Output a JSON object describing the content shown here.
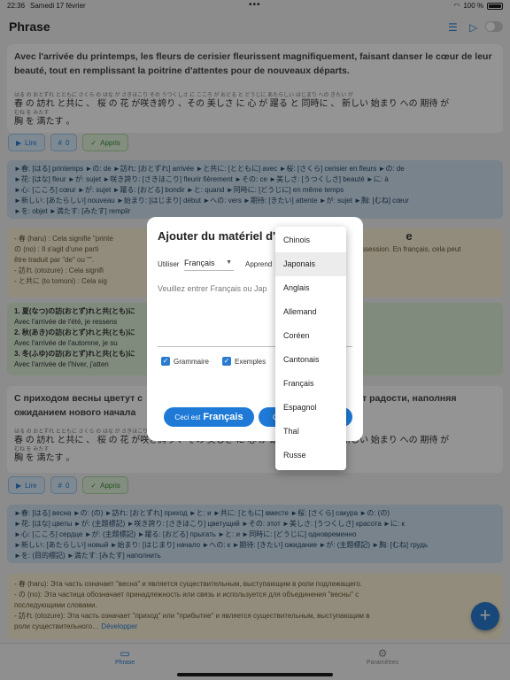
{
  "status": {
    "time": "22:36",
    "date": "Samedi 17 février",
    "battery": "100 %"
  },
  "nav": {
    "title": "Phrase",
    "list_icon": "list-icon",
    "play_icon": "play-icon"
  },
  "card1": {
    "sentence": "Avec l'arrivée du printemps, les fleurs de cerisier fleurissent magnifiquement, faisant danser le cœur de leur beauté, tout en remplissant la poitrine d'attentes pour de nouveaux départs.",
    "furigana": "はる の おとずれ とともに     さくら の はな が さきほこり    その うつくしさ に こころ が おどる と どうじに    あたらしい はじまり への きたい が",
    "japanese": "春 の 訪れ と共に 、 桜 の 花 が咲き誇り 、その 美しさ に 心 が 躍る と 同時に 、 新しい 始まり への 期待 が",
    "furigana2": "むね を  みたす",
    "japanese2": "胸 を 満たす 。"
  },
  "buttons": {
    "read": "Lire",
    "count": "0",
    "learned": "Appris"
  },
  "vocab1": [
    "►春: [はる] printemps ►の: de ►訪れ: [おとずれ] arrivée ►と共に: [とともに] avec ►桜: [さくら] cerisier en fleurs ►の: de",
    "►花: [はな] fleur ►が: sujet ►咲き誇り: [さきほこり] fleurir fièrement ►その: ce ►美しさ: [うつくしさ] beauté ►に: à",
    "►心: [こころ] cœur ►が: sujet ►躍る: [おどる] bondir ►と: quand ►同時に: [どうじに] en même temps",
    "►新しい: [あたらしい] nouveau ►始まり: [はじまり] début ►への: vers ►期待: [きたい] attente ►が: sujet ►胸: [むね] cœur",
    "►を: objet ►満たす: [みたす] remplir"
  ],
  "grammar1": [
    "- 春 (haru) : Cela signifie \"printe",
    "     の (no) : Il s'agit d'une parti",
    "être traduit par \"de\" ou \"\".",
    "     - 訪れ (otozure) : Cela signifi",
    "     - と共に (to tomoni) : Cela sig"
  ],
  "grammar1_right": "ssession. En français, cela peut",
  "examples1": [
    "1. 夏(なつ)の訪(おとず)れと共(とも)に",
    "Avec l'arrivée de l'été, je ressens",
    "2. 秋(あき)の訪(おとず)れと共(とも)に",
    "Avec l'arrivée de l'automne, je su",
    "3. 冬(ふゆ)の訪(おとず)れと共(とも)に",
    "Avec l'arrivée de l'hiver, j'atten"
  ],
  "card2": {
    "sentence_left": "С приходом весны цветут с",
    "sentence_left2": "ожиданием нового начала",
    "sentence_right": "ся от радости, наполняя",
    "furigana": "はる の おとずれ とともに     さくら の はな が さきほこり    その うつくしさ に こころ が おどる と どうじに    あたらしい はじまり への きたい が",
    "japanese": "春 の 訪れ と共に 、 桜 の 花 が咲き誇り 、その 美しさ に 心 が 躍る と 同時に 、 新しい 始まり への 期待 が",
    "furigana2": "むね を  みたす",
    "japanese2": "胸 を 満たす 。"
  },
  "vocab2": [
    "►春: [はる] весна ►の: (の) ►訪れ: [おとずれ] приход ►と: и ►共に: [ともに] вместе ►桜: [さくら] сакура ►の: (の)",
    "►花: [はな] цветы ►が: (主題標記) ►咲き誇り: [さきほこり] цветущий ►その: этот ►美しさ: [うつくしさ] красота ►に: к",
    "►心: [こころ] сердце ►が: (主題標記) ►躍る: [おどる] прыгать ►と: и ►同時に: [どうじに] одновременно",
    "►新しい: [あたらしい] новый ►始まり: [はじまり] начало ►への: к ►期待: [きたい] ожидание ►が: (主題標記) ►胸: [むね] грудь",
    "►を: (目的標記) ►満たす: [みたす] наполнить"
  ],
  "grammar2": [
    "- 春 (haru): Эта часть означает \"весна\" и является существительным, выступающим в роли подлежащего.",
    "     - の (no): Эта частица обозначает принадлежность или связь и используется для объединения \"весны\" с",
    "последующими словами.",
    "     - 訪れ (otozure): Эта часть означает \"приход\" или \"прибытие\" и является существительным, выступающим в",
    "роли существительного…"
  ],
  "grammar2_more": "Développer",
  "fab": "+",
  "tabs": {
    "phrase": "Phrase",
    "settings": "Paramètres"
  },
  "modal": {
    "title": "Ajouter du matériel d'a",
    "title_tail": "e",
    "use_label": "Utiliser",
    "use_value": "Français",
    "learn_label": "Apprend",
    "placeholder": "Veuillez entrer Français ou Jap",
    "chk_grammar": "Grammaire",
    "chk_examples": "Exemples",
    "btn_is": "Ceci est",
    "btn_is_lang": "Français",
    "btn2": "C"
  },
  "dropdown": {
    "options": [
      "Chinois",
      "Japonais",
      "Anglais",
      "Allemand",
      "Coréen",
      "Cantonais",
      "Français",
      "Espagnol",
      "Thaï",
      "Russe"
    ],
    "selected": "Japonais"
  },
  "colors": {
    "accent": "#2a7bd0",
    "vocab_bg": "#cfe2ef",
    "grammar_bg": "#fbf1d7",
    "examples_bg": "#ddefd8"
  }
}
